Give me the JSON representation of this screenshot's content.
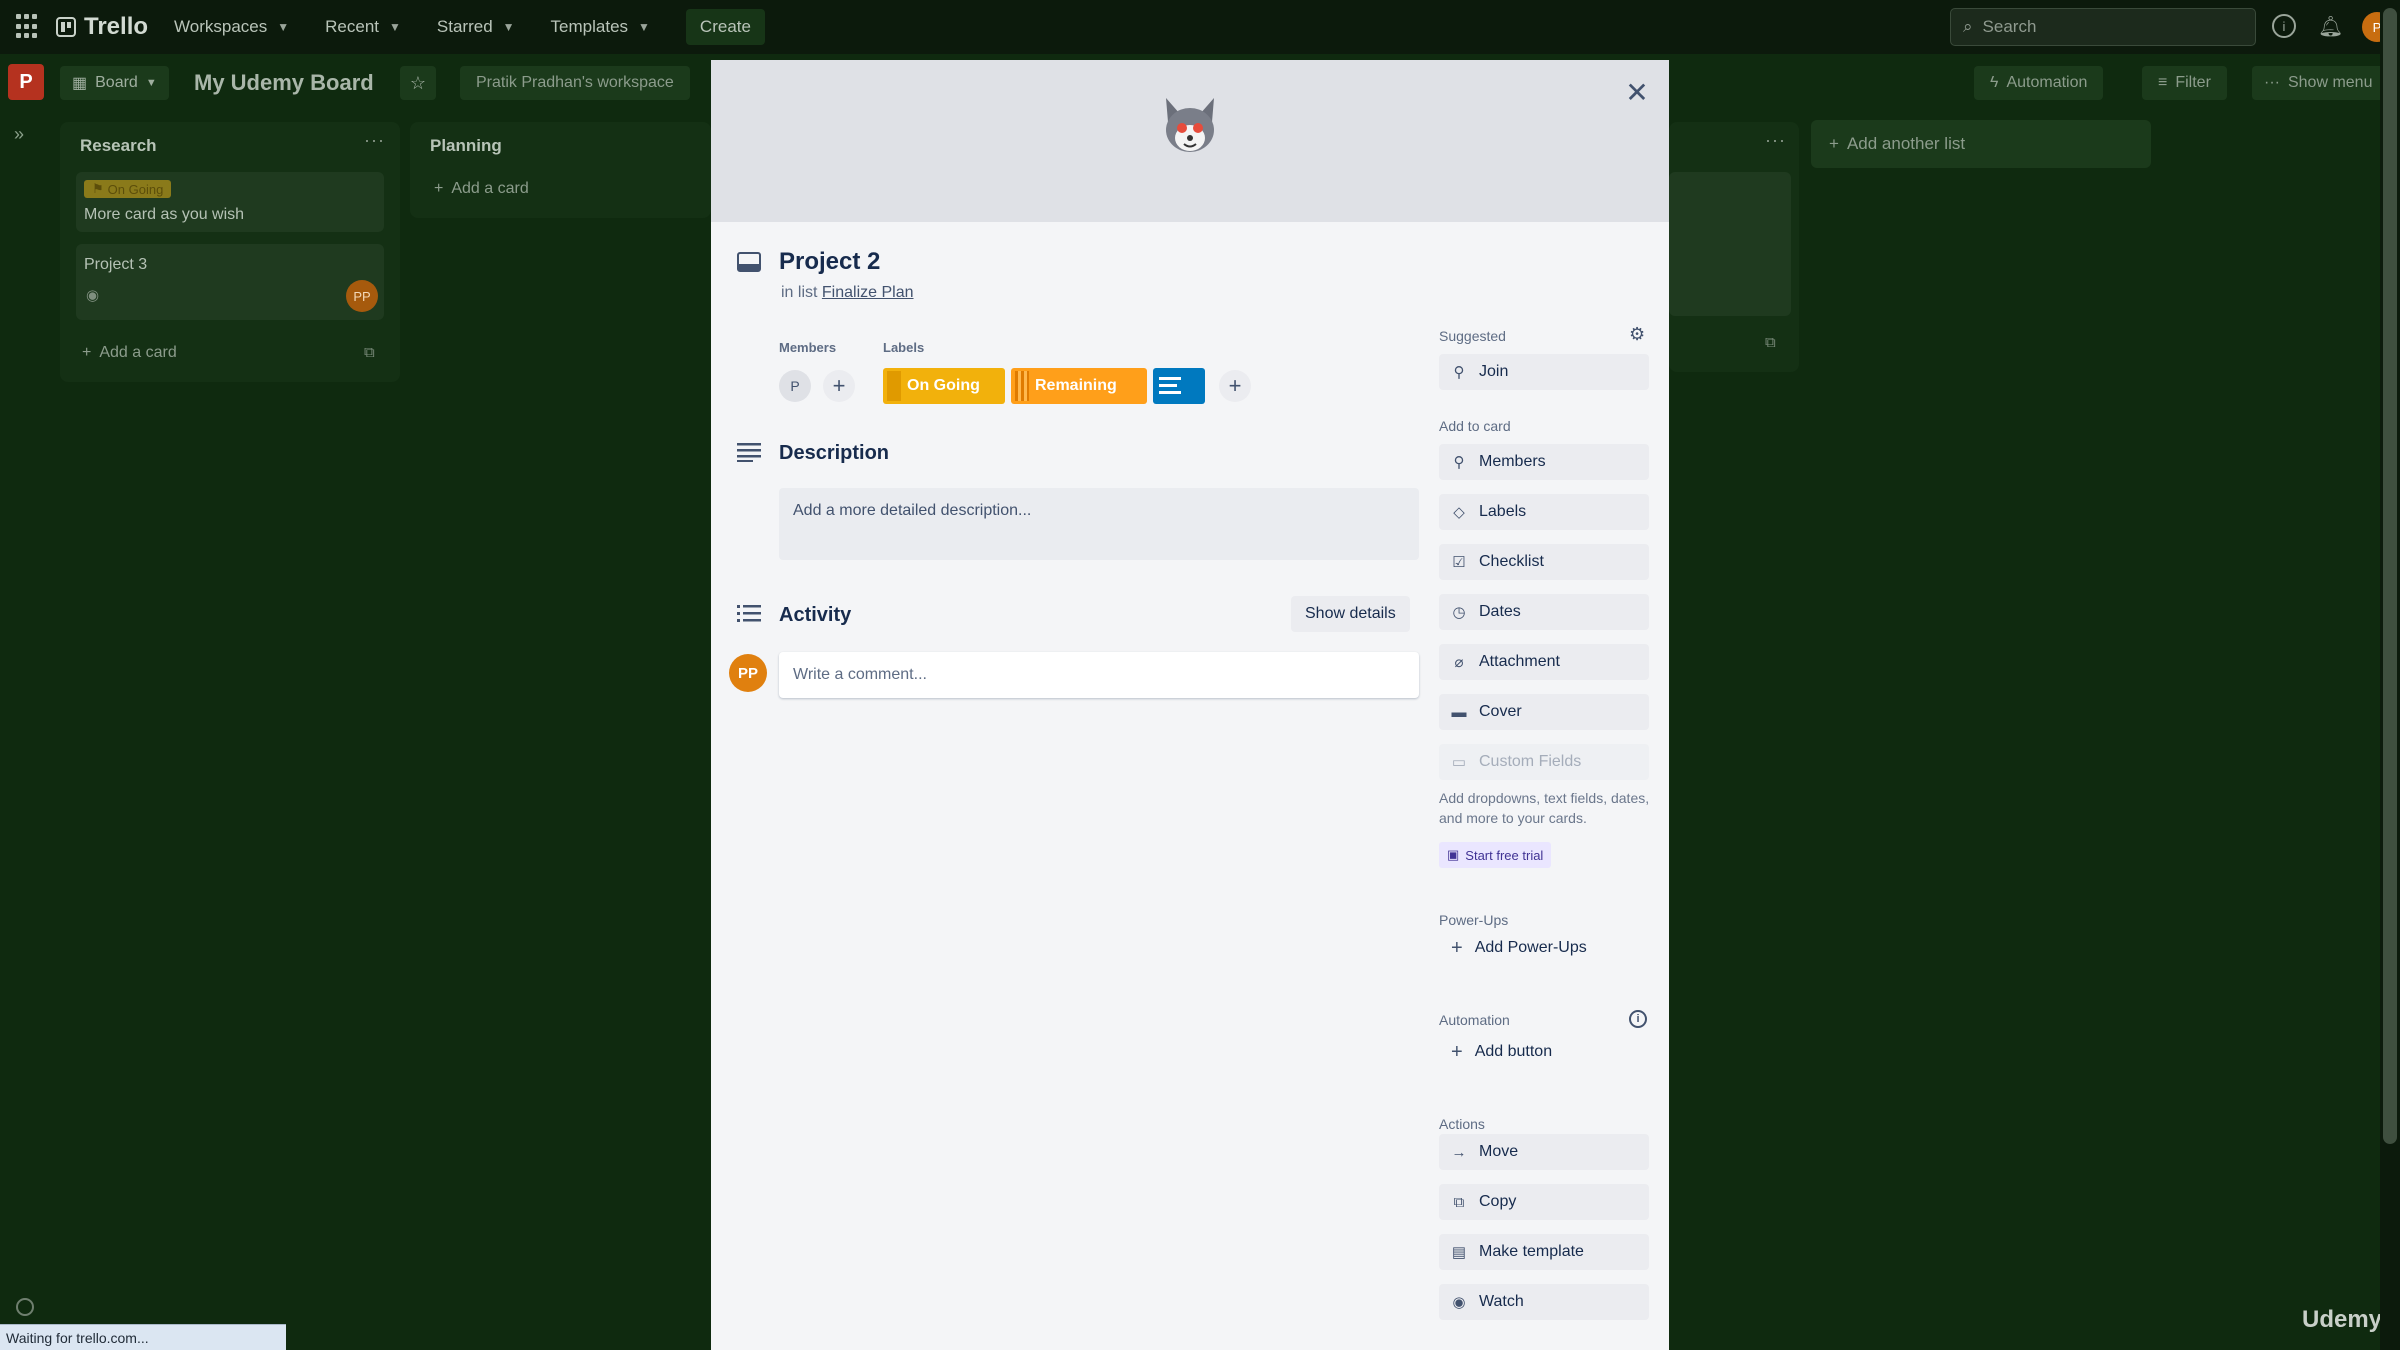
{
  "topbar": {
    "app_name": "Trello",
    "nav": [
      {
        "label": "Workspaces"
      },
      {
        "label": "Recent"
      },
      {
        "label": "Starred"
      },
      {
        "label": "Templates"
      }
    ],
    "create_label": "Create",
    "search_placeholder": "Search",
    "avatar_initials": "P"
  },
  "board": {
    "workspace_initial": "P",
    "view_label": "Board",
    "title": "My Udemy Board",
    "workspace_name": "Pratik Pradhan's workspace",
    "automation_label": "Automation",
    "filter_label": "Filter",
    "show_menu_label": "Show menu",
    "add_another_list": "Add another list"
  },
  "lists": [
    {
      "title": "Research",
      "cards": [
        {
          "label": "On Going",
          "text": "More card as you wish"
        },
        {
          "text": "Project 3",
          "avatar": "PP"
        }
      ],
      "add_card": "Add a card"
    },
    {
      "title": "Planning",
      "add_card": "Add a card"
    }
  ],
  "modal": {
    "card_title": "Project 2",
    "in_list_prefix": "in list",
    "list_name": "Finalize Plan",
    "members_label": "Members",
    "member_initial": "P",
    "labels_label": "Labels",
    "labels": [
      {
        "text": "On Going",
        "color": "#f2b10c"
      },
      {
        "text": "Remaining",
        "color": "#ff9f1a"
      },
      {
        "text": "",
        "color": "#0079bf"
      }
    ],
    "description_heading": "Description",
    "description_placeholder": "Add a more detailed description...",
    "activity_heading": "Activity",
    "show_details": "Show details",
    "commenter_initials": "PP",
    "comment_placeholder": "Write a comment...",
    "sidebar": {
      "suggested": "Suggested",
      "join": "Join",
      "add_to_card": "Add to card",
      "add_items": [
        {
          "label": "Members",
          "icon": "person-icon"
        },
        {
          "label": "Labels",
          "icon": "tag-icon"
        },
        {
          "label": "Checklist",
          "icon": "checklist-icon"
        },
        {
          "label": "Dates",
          "icon": "clock-icon"
        },
        {
          "label": "Attachment",
          "icon": "paperclip-icon"
        },
        {
          "label": "Cover",
          "icon": "cover-icon"
        },
        {
          "label": "Custom Fields",
          "icon": "fields-icon"
        }
      ],
      "custom_fields_note": "Add dropdowns, text fields, dates, and more to your cards.",
      "start_trial": "Start free trial",
      "powerups_head": "Power-Ups",
      "add_powerups": "Add Power-Ups",
      "automation_head": "Automation",
      "add_button": "Add button",
      "actions_head": "Actions",
      "actions": [
        {
          "label": "Move",
          "icon": "arrow-right-icon"
        },
        {
          "label": "Copy",
          "icon": "copy-icon"
        },
        {
          "label": "Make template",
          "icon": "template-icon"
        },
        {
          "label": "Watch",
          "icon": "eye-icon"
        }
      ]
    }
  },
  "status_text": "Waiting for trello.com...",
  "watermark": "Udemy"
}
